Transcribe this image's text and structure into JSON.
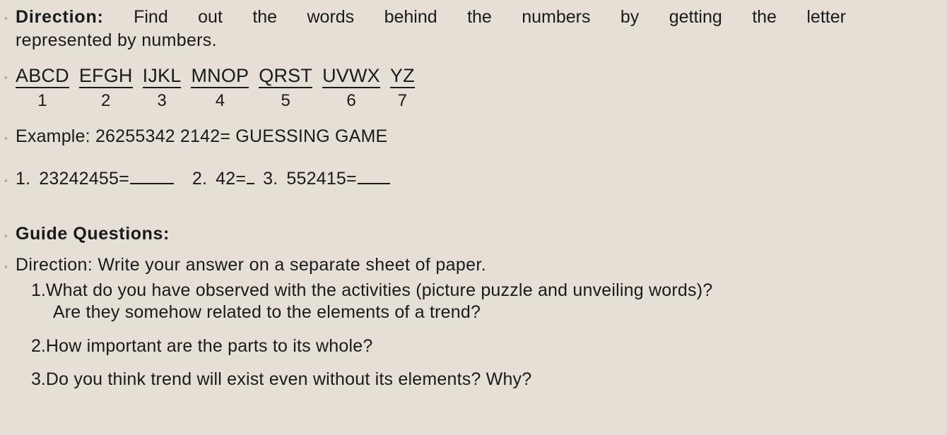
{
  "slide": {
    "background_color": "#e6dfd6",
    "text_color": "#1a1a1a",
    "bullet_glyph": "◦"
  },
  "direction": {
    "label": "Direction:",
    "line1_words": [
      "Find",
      "out",
      "the",
      "words",
      "behind",
      "the",
      "numbers",
      "by",
      "getting",
      "the",
      "letter"
    ],
    "line2": "represented by numbers."
  },
  "alphabet_key": {
    "groups": [
      {
        "letters": "ABCD",
        "number": "1"
      },
      {
        "letters": "EFGH",
        "number": "2"
      },
      {
        "letters": "IJKL",
        "number": "3"
      },
      {
        "letters": "MNOP",
        "number": "4"
      },
      {
        "letters": "QRST",
        "number": "5"
      },
      {
        "letters": "UVWX",
        "number": "6"
      },
      {
        "letters": "YZ",
        "number": "7"
      }
    ]
  },
  "example": {
    "text": "Example: 26255342 2142= GUESSING GAME",
    "label": "Example:",
    "code": "26255342 2142=",
    "answer": "GUESSING GAME"
  },
  "exercise": {
    "items": [
      {
        "number": "1.",
        "code": "23242455=",
        "blank": "___"
      },
      {
        "number": "2.",
        "code": "42=",
        "blank": "_"
      },
      {
        "number": "3.",
        "code": "552415=",
        "blank": "__"
      }
    ]
  },
  "guide": {
    "heading": "Guide Questions:",
    "direction": "Direction: Write your answer on a separate sheet of paper.",
    "questions": [
      {
        "number": "1.",
        "line1": "What do you have observed with the activities (picture puzzle and unveiling words)?",
        "line2": "Are they somehow related to the elements of a trend?"
      },
      {
        "number": "2.",
        "line1": "How important are the parts to its whole?",
        "line2": ""
      },
      {
        "number": "3.",
        "line1": "Do you think trend will exist even without its elements? Why?",
        "line2": ""
      }
    ]
  }
}
